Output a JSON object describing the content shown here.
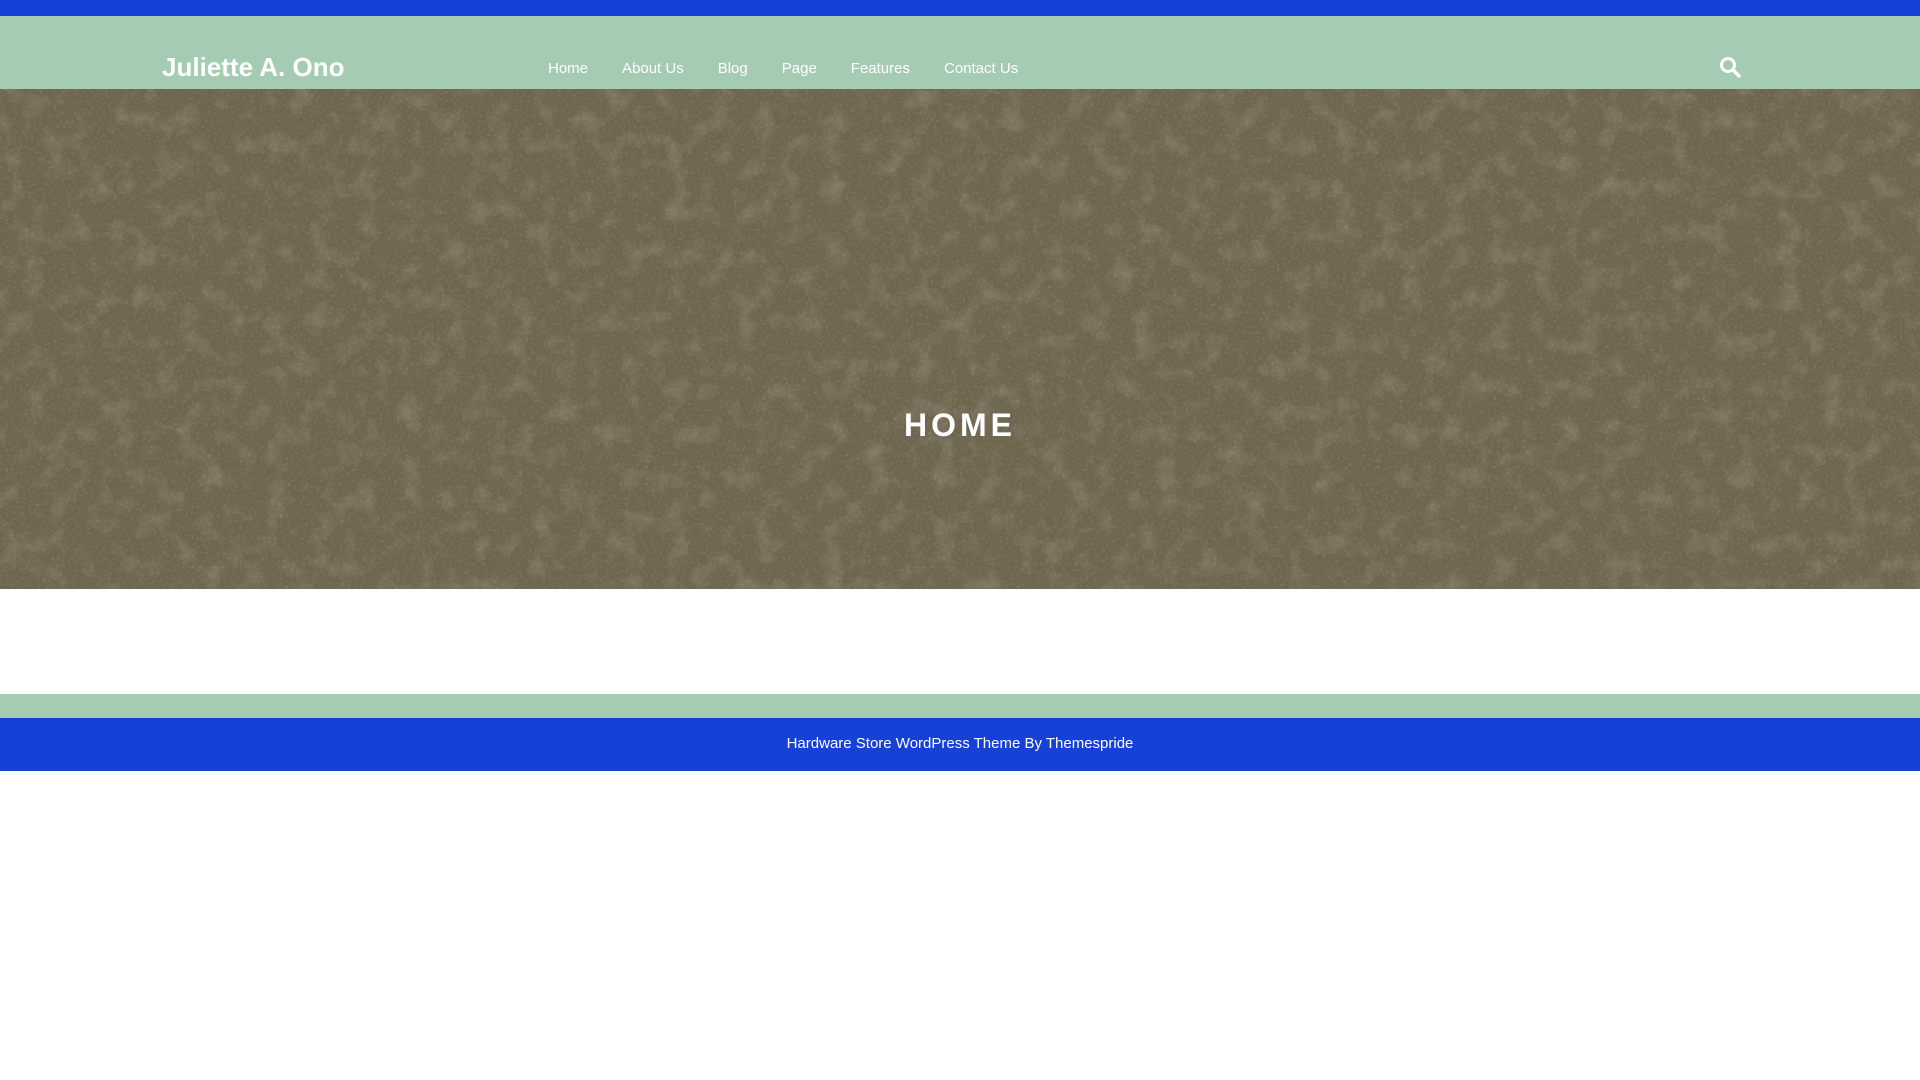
{
  "colors": {
    "top_strip": "#1740d6",
    "header_bg": "#a6cbb3",
    "hero_bg": "#6f6650",
    "footer_bg": "#1740d6",
    "text": "#ffffff"
  },
  "header": {
    "site_title": "Juliette A. Ono",
    "nav": [
      "Home",
      "About Us",
      "Blog",
      "Page",
      "Features",
      "Contact Us"
    ],
    "search_icon": "search-icon"
  },
  "hero": {
    "title": "HOME"
  },
  "footer": {
    "credit": "Hardware Store WordPress Theme By Themespride"
  }
}
